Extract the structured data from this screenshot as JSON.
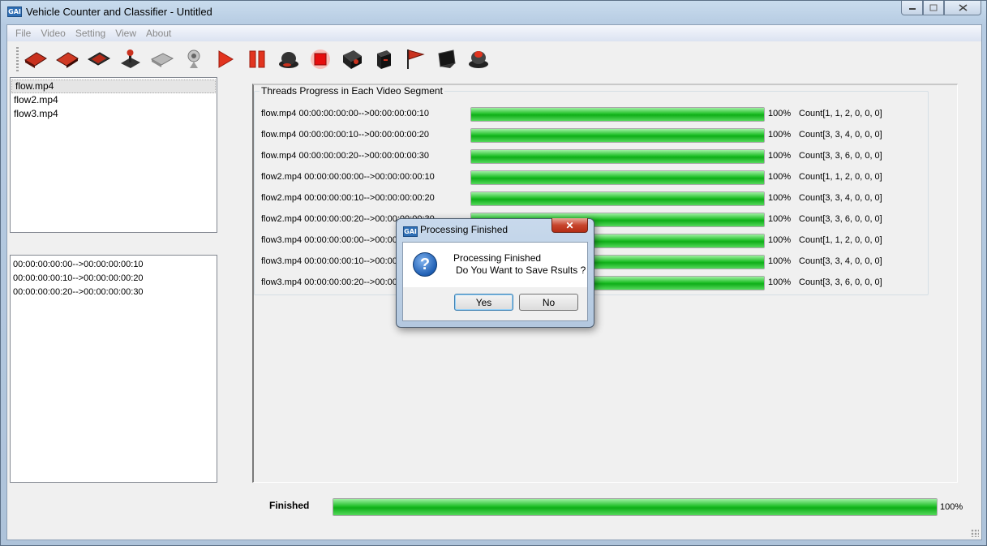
{
  "window": {
    "title": "Vehicle Counter and Classifier - Untitled",
    "icon_text": "GAI"
  },
  "menu": [
    "File",
    "Video",
    "Setting",
    "View",
    "About"
  ],
  "toolbar_icons": [
    "open-video-icon",
    "open-folder-icon",
    "load-config-icon",
    "joystick-icon",
    "disk-icon",
    "webcam-icon",
    "play-icon",
    "pause-icon",
    "record-icon",
    "stop-icon",
    "settings-box-icon",
    "export-icon",
    "flag-icon",
    "monitor-icon",
    "exit-icon"
  ],
  "files": [
    "flow.mp4",
    "flow2.mp4",
    "flow3.mp4"
  ],
  "segments": [
    "00:00:00:00:00-->00:00:00:00:10",
    "00:00:00:00:10-->00:00:00:00:20",
    "00:00:00:00:20-->00:00:00:00:30"
  ],
  "threads": {
    "group_title": "Threads Progress in Each Video Segment",
    "rows": [
      {
        "label": "flow.mp4 00:00:00:00:00-->00:00:00:00:10",
        "progress": 100,
        "pct": "100%",
        "count": "Count[1, 1, 2, 0, 0, 0]"
      },
      {
        "label": "flow.mp4 00:00:00:00:10-->00:00:00:00:20",
        "progress": 100,
        "pct": "100%",
        "count": "Count[3, 3, 4, 0, 0, 0]"
      },
      {
        "label": "flow.mp4 00:00:00:00:20-->00:00:00:00:30",
        "progress": 100,
        "pct": "100%",
        "count": "Count[3, 3, 6, 0, 0, 0]"
      },
      {
        "label": "flow2.mp4 00:00:00:00:00-->00:00:00:00:10",
        "progress": 100,
        "pct": "100%",
        "count": "Count[1, 1, 2, 0, 0, 0]"
      },
      {
        "label": "flow2.mp4 00:00:00:00:10-->00:00:00:00:20",
        "progress": 100,
        "pct": "100%",
        "count": "Count[3, 3, 4, 0, 0, 0]"
      },
      {
        "label": "flow2.mp4 00:00:00:00:20-->00:00:00:00:30",
        "progress": 100,
        "pct": "100%",
        "count": "Count[3, 3, 6, 0, 0, 0]"
      },
      {
        "label": "flow3.mp4 00:00:00:00:00-->00:00:00:00:10",
        "progress": 100,
        "pct": "100%",
        "count": "Count[1, 1, 2, 0, 0, 0]"
      },
      {
        "label": "flow3.mp4 00:00:00:00:10-->00:00:00:00:20",
        "progress": 100,
        "pct": "100%",
        "count": "Count[3, 3, 4, 0, 0, 0]"
      },
      {
        "label": "flow3.mp4 00:00:00:00:20-->00:00:00:00:30",
        "progress": 100,
        "pct": "100%",
        "count": "Count[3, 3, 6, 0, 0, 0]"
      }
    ]
  },
  "overall": {
    "label": "Finished",
    "progress": 100,
    "pct": "100%"
  },
  "dialog": {
    "title": "Processing Finished",
    "icon_text": "GAI",
    "line1": "Processing Finished",
    "line2": "Do You Want to Save Rsults ?",
    "yes": "Yes",
    "no": "No",
    "close": "✕"
  },
  "colors": {
    "progress_green": "#22c02a",
    "close_red": "#c7452d"
  }
}
